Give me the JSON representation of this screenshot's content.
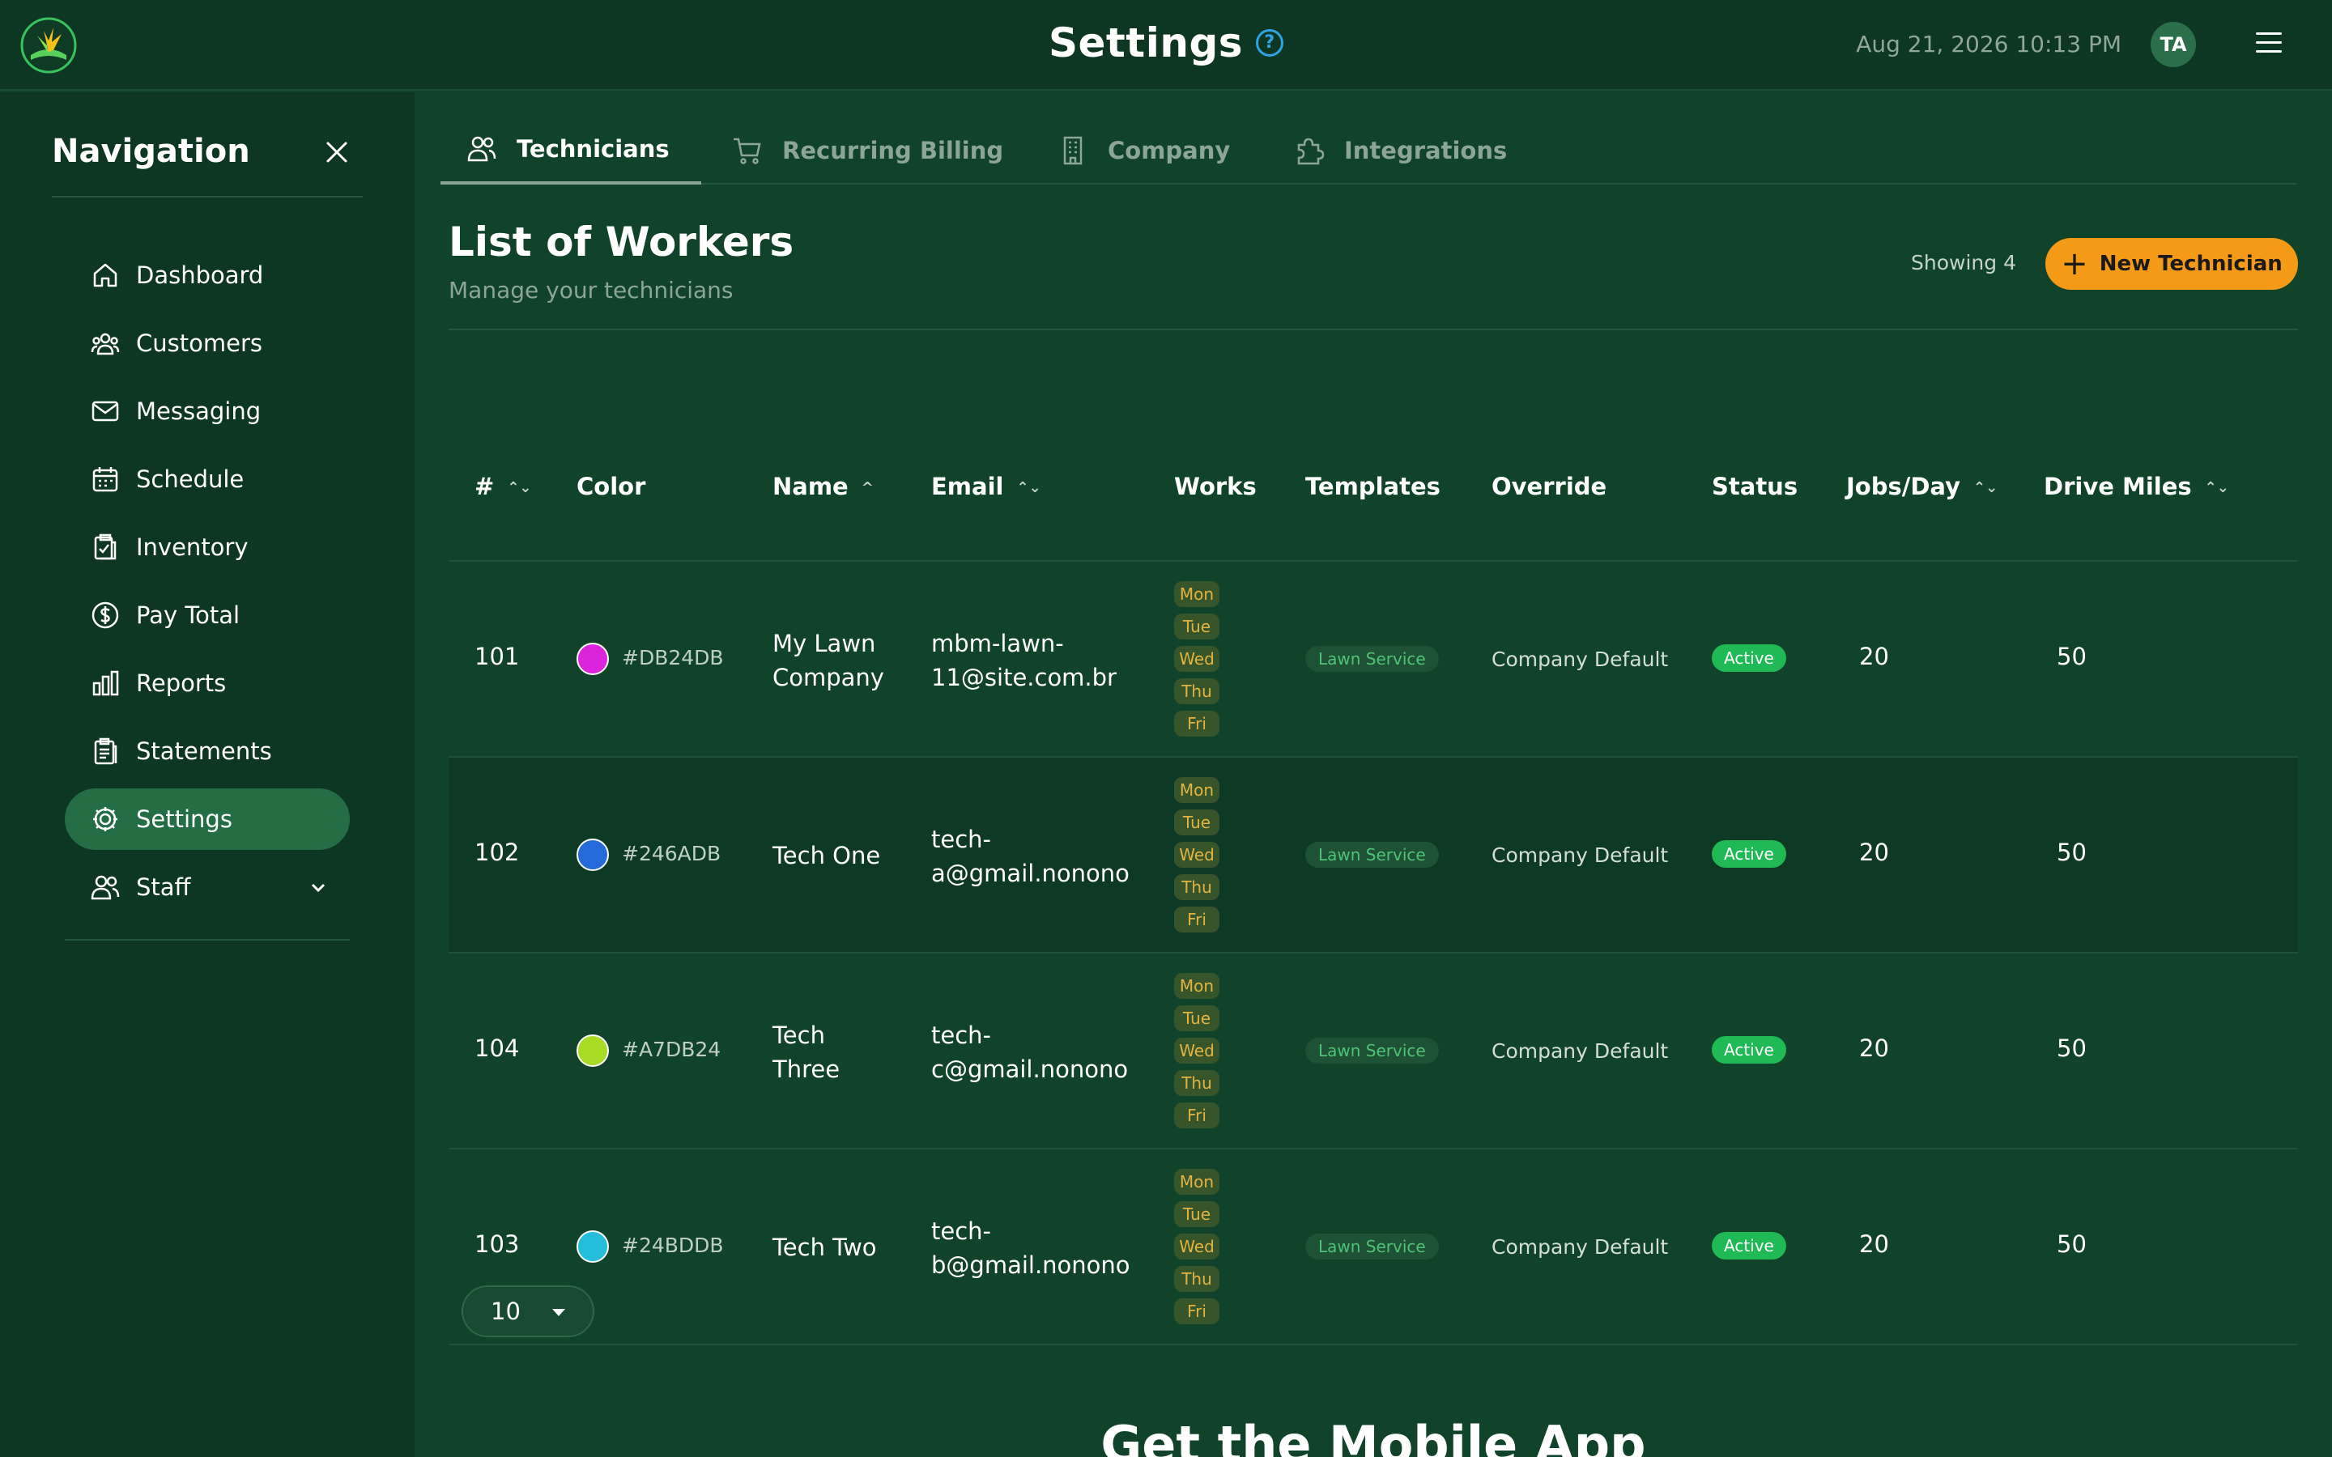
{
  "header": {
    "title": "Settings",
    "help_glyph": "?",
    "datetime": "Aug 21, 2026 10:13 PM",
    "avatar_initials": "TA",
    "icons": [
      "logo-icon",
      "help-icon",
      "menu-icon"
    ]
  },
  "sidebar": {
    "title": "Navigation",
    "items": [
      {
        "label": "Dashboard",
        "icon": "home-icon"
      },
      {
        "label": "Customers",
        "icon": "users-icon"
      },
      {
        "label": "Messaging",
        "icon": "mail-icon"
      },
      {
        "label": "Schedule",
        "icon": "calendar-icon"
      },
      {
        "label": "Inventory",
        "icon": "clipboard-icon"
      },
      {
        "label": "Pay Total",
        "icon": "dollar-icon"
      },
      {
        "label": "Reports",
        "icon": "bar-chart-icon"
      },
      {
        "label": "Statements",
        "icon": "document-icon"
      },
      {
        "label": "Settings",
        "icon": "gear-icon",
        "active": true
      },
      {
        "label": "Staff",
        "icon": "staff-icon",
        "expandable": true
      }
    ]
  },
  "tabs": [
    {
      "label": "Technicians",
      "icon": "users-icon",
      "active": true
    },
    {
      "label": "Recurring Billing",
      "icon": "cart-icon"
    },
    {
      "label": "Company",
      "icon": "building-icon"
    },
    {
      "label": "Integrations",
      "icon": "puzzle-icon"
    }
  ],
  "list": {
    "title": "List of Workers",
    "subtitle": "Manage your technicians",
    "showing": "Showing 4",
    "new_button": "New Technician",
    "new_button_icon": "+"
  },
  "table": {
    "columns": [
      "#",
      "Color",
      "Name",
      "Email",
      "Works",
      "Templates",
      "Override",
      "Status",
      "Jobs/Day",
      "Drive Miles"
    ],
    "sort_glyphs": {
      "sortable": "⌃⌄",
      "asc": "^"
    },
    "rows": [
      {
        "id": "101",
        "color": "#DB24DB",
        "name": [
          "My Lawn",
          "Company"
        ],
        "email": [
          "mbm-lawn-",
          "11@site.com.br"
        ],
        "days": [
          "Mon",
          "Tue",
          "Wed",
          "Thu",
          "Fri"
        ],
        "template": "Lawn Service",
        "override": "Company Default",
        "status": "Active",
        "jobs": "20",
        "miles": "50"
      },
      {
        "id": "102",
        "color": "#246ADB",
        "name": [
          "Tech One"
        ],
        "email": [
          "tech-",
          "a@gmail.nonono"
        ],
        "days": [
          "Mon",
          "Tue",
          "Wed",
          "Thu",
          "Fri"
        ],
        "template": "Lawn Service",
        "override": "Company Default",
        "status": "Active",
        "jobs": "20",
        "miles": "50"
      },
      {
        "id": "104",
        "color": "#A7DB24",
        "name": [
          "Tech",
          "Three"
        ],
        "email": [
          "tech-",
          "c@gmail.nonono"
        ],
        "days": [
          "Mon",
          "Tue",
          "Wed",
          "Thu",
          "Fri"
        ],
        "template": "Lawn Service",
        "override": "Company Default",
        "status": "Active",
        "jobs": "20",
        "miles": "50"
      },
      {
        "id": "103",
        "color": "#24BDDB",
        "name": [
          "Tech Two"
        ],
        "email": [
          "tech-",
          "b@gmail.nonono"
        ],
        "days": [
          "Mon",
          "Tue",
          "Wed",
          "Thu",
          "Fri"
        ],
        "template": "Lawn Service",
        "override": "Company Default",
        "status": "Active",
        "jobs": "20",
        "miles": "50"
      }
    ]
  },
  "pagination": {
    "per_page": "10"
  },
  "footer": {
    "mobile_title": "Get the Mobile App"
  },
  "colors": {
    "accent": "#f59a16",
    "active": "#1fb955",
    "sidebar_active": "#236e45"
  }
}
